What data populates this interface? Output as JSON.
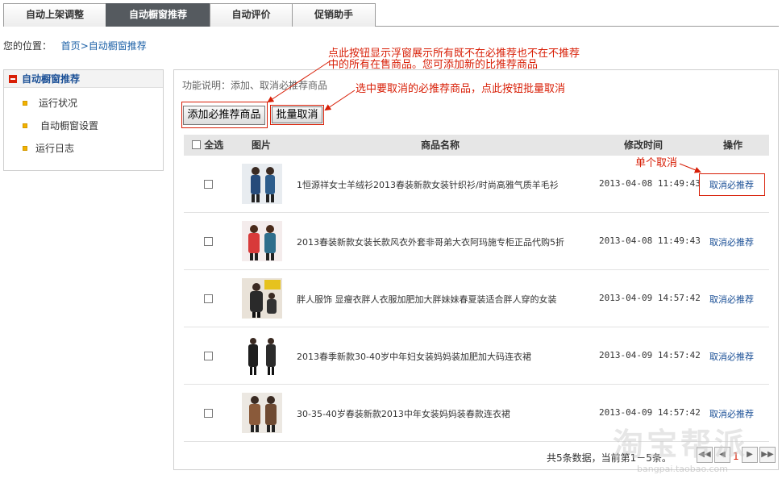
{
  "tabs": [
    {
      "label": "自动上架调整",
      "active": false
    },
    {
      "label": "自动橱窗推荐",
      "active": true
    },
    {
      "label": "自动评价",
      "active": false
    },
    {
      "label": "促销助手",
      "active": false
    }
  ],
  "breadcrumb": {
    "prefix": "您的位置：",
    "home": "首页",
    "separator": ">",
    "current": "自动橱窗推荐"
  },
  "sidebar": {
    "title": "自动橱窗推荐",
    "items": [
      {
        "label": "运行状况"
      },
      {
        "label": "自动橱窗设置"
      },
      {
        "label": "运行日志"
      }
    ]
  },
  "main": {
    "func_desc": "功能说明：添加、取消必推荐商品",
    "add_button": "添加必推荐商品",
    "batch_cancel_button": "批量取消",
    "columns": {
      "select_all": "全选",
      "image": "图片",
      "name": "商品名称",
      "modified": "修改时间",
      "action": "操作"
    },
    "rows": [
      {
        "name": "1恒源祥女士羊绒衫2013春装新款女装针织衫/时尚高雅气质羊毛衫",
        "time": "2013-04-08 11:49:43",
        "action": "取消必推荐"
      },
      {
        "name": "2013春装新款女装长款风衣外套非哥弟大衣阿玛施专柜正品代购5折",
        "time": "2013-04-08 11:49:43",
        "action": "取消必推荐"
      },
      {
        "name": "胖人服饰 显瘦衣胖人衣服加肥加大胖妹妹春夏装适合胖人穿的女装",
        "time": "2013-04-09 14:57:42",
        "action": "取消必推荐"
      },
      {
        "name": "2013春季新款30-40岁中年妇女装妈妈装加肥加大码连衣裙",
        "time": "2013-04-09 14:57:42",
        "action": "取消必推荐"
      },
      {
        "name": "30-35-40岁春装新款2013中年女装妈妈装春款连衣裙",
        "time": "2013-04-09 14:57:42",
        "action": "取消必推荐"
      }
    ],
    "pager": {
      "summary": "共5条数据，当前第1－5条。",
      "current_page": "1"
    }
  },
  "annotations": {
    "add_note_line1": "点此按钮显示浮窗展示所有既不在必推荐也不在不推荐",
    "add_note_line2": "中的所有在售商品。您可添加新的比推荐商品",
    "batch_note": "选中要取消的必推荐商品，点此按钮批量取消",
    "single_note": "单个取消"
  },
  "watermark": {
    "text": "淘宝帮派",
    "url": "bangpai.taobao.com"
  },
  "colors": {
    "accent_red": "#d81e06",
    "link_blue": "#1a4f96",
    "active_tab": "#555a5f"
  }
}
